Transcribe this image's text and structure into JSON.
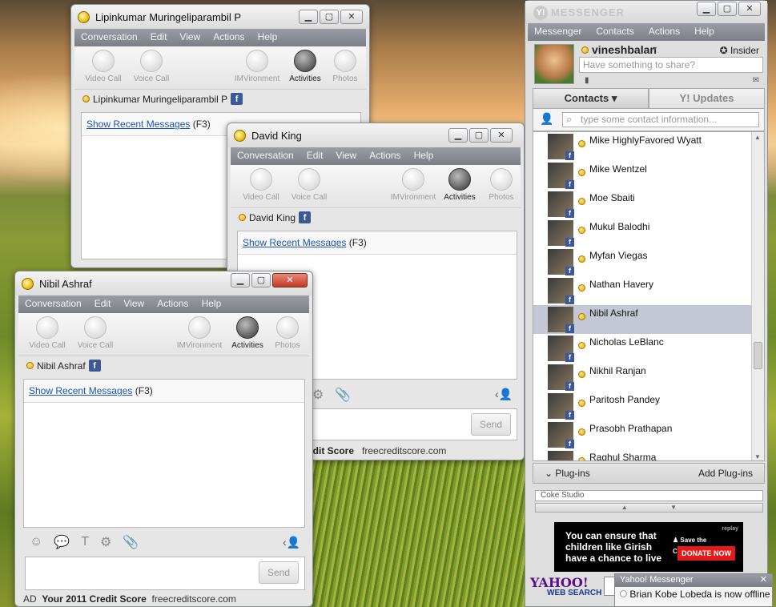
{
  "win1": {
    "title": "Lipinkumar Muringeliparambil P",
    "buddy": "Lipinkumar Muringeliparambil P",
    "recent": "Show Recent Messages",
    "recent_key": "(F3)"
  },
  "win2": {
    "title": "David King",
    "buddy": "David King",
    "recent": "Show Recent Messages",
    "recent_key": "(F3)",
    "send": "Send",
    "ad_bold": "edit Score",
    "ad_url": "freecreditscore.com"
  },
  "win3": {
    "title": "Nibil Ashraf",
    "buddy": "Nibil Ashraf",
    "recent": "Show Recent Messages",
    "recent_key": "(F3)",
    "send": "Send",
    "ad_tag": "AD",
    "ad_bold": "Your 2011 Credit Score",
    "ad_url": "freecreditscore.com"
  },
  "im_menu": [
    "Conversation",
    "Edit",
    "View",
    "Actions",
    "Help"
  ],
  "im_tools": [
    "Video Call",
    "Voice Call",
    "IMVironment",
    "Activities",
    "Photos"
  ],
  "messenger": {
    "title": "MESSENGER",
    "menu": [
      "Messenger",
      "Contacts",
      "Actions",
      "Help"
    ],
    "user": "vineshbalan",
    "insider": "Insider",
    "status_placeholder": "Have something to share?",
    "tab_contacts": "Contacts",
    "tab_updates": "Y! Updates",
    "search_placeholder": "type some contact information...",
    "contacts": [
      "Mike HighlyFavored Wyatt",
      "Mike Wentzel",
      "Moe Sbaiti",
      "Mukul Balodhi",
      "Myfan Viegas",
      "Nathan Havery",
      "Nibil Ashraf",
      "Nicholas LeBlanc",
      "Nikhil Ranjan",
      "Paritosh Pandey",
      "Prasobh Prathapan",
      "Raghul Sharma"
    ],
    "selected": "Nibil Ashraf",
    "plugins": "Plug-ins",
    "add_plugins": "Add Plug-ins",
    "plugin_item": "Coke Studio",
    "banner_text": "You can ensure that children like Girish have a chance to live",
    "banner_org": "Save the Children",
    "banner_btn": "DONATE NOW",
    "banner_tag": "replay",
    "yahoo": "YAHOO!",
    "web_search": "WEB SEARCH"
  },
  "toast": {
    "header": "Yahoo! Messenger",
    "message": "Brian Kobe Lobeda is now offline"
  }
}
